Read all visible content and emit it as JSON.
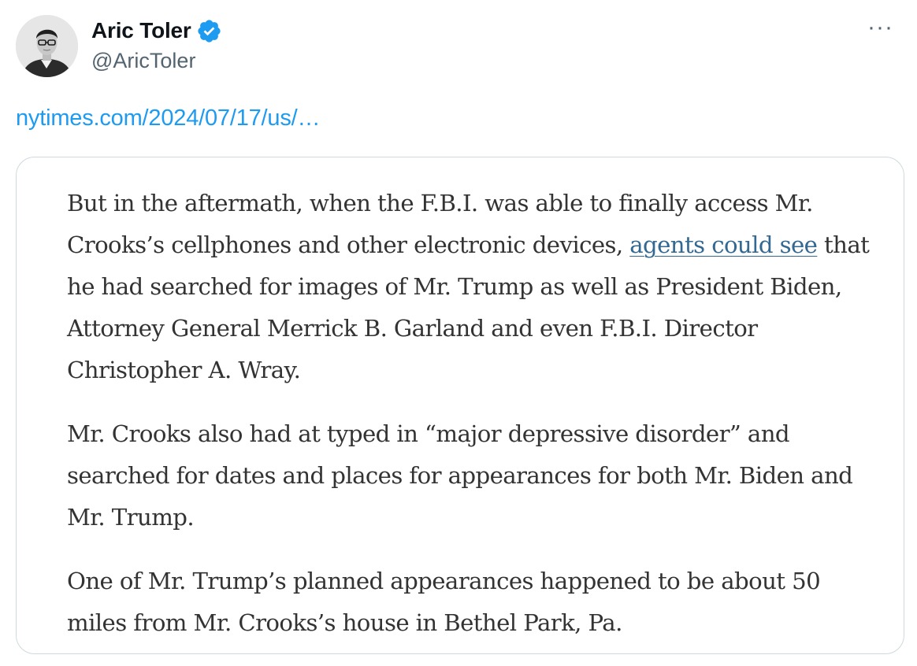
{
  "author": {
    "display_name": "Aric Toler",
    "handle": "@AricToler",
    "verified": true
  },
  "more_menu": "···",
  "tweet_link": "nytimes.com/2024/07/17/us/…",
  "card": {
    "paragraphs": [
      {
        "before": "But in the aftermath, when the F.B.I. was able to finally access Mr. Crooks’s cellphones and other electronic devices, ",
        "link": "agents could see",
        "after": " that he had searched for images of Mr. Trump as well as President Biden, Attorney General Merrick B. Garland and even F.B.I. Director Christopher A. Wray."
      },
      {
        "text": "Mr. Crooks also had at typed in “major depressive disorder” and searched for dates and places for appearances for both Mr. Biden and Mr. Trump."
      },
      {
        "text": "One of Mr. Trump’s planned appearances happened to be about 50 miles from Mr. Crooks’s house in Bethel Park, Pa."
      }
    ]
  },
  "colors": {
    "link_blue": "#1d9bf0",
    "verified_blue": "#1d9bf0",
    "article_link": "#326891",
    "text_secondary": "#536471",
    "card_border": "#cfd9de"
  },
  "icons": {
    "verified": "verified-badge-icon",
    "more": "more-horizontal-icon"
  }
}
